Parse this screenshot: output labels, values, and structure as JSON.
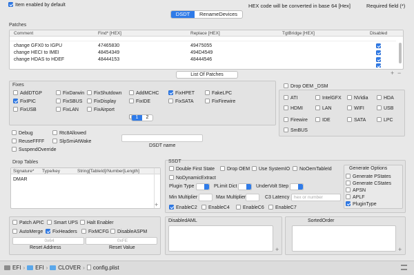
{
  "top": {
    "item_enabled_label": "Item enabled by default",
    "hex_note": "HEX code will be converted in base 64 [Hex]",
    "required_note": "Required field (*)",
    "tabs": [
      "DSDT",
      "RenameDevices"
    ]
  },
  "patches": {
    "title": "Patches",
    "columns": [
      "Comment",
      "Find* [HEX]",
      "Replace [HEX]",
      "TgtBridge [HEX]",
      "Disabled"
    ],
    "rows": [
      {
        "comment": "change GFX0 to IGPU",
        "find": "47465830",
        "replace": "49475055"
      },
      {
        "comment": "change HECI to IMEI",
        "find": "48454349",
        "replace": "494D4549"
      },
      {
        "comment": "change HDAS to HDEF",
        "find": "48444153",
        "replace": "48444546"
      }
    ],
    "list_button": "List Of Patches",
    "plus": "+",
    "minus": "−"
  },
  "fixes": {
    "title": "Fixes",
    "items": [
      {
        "label": "AddDTGP",
        "checked": false
      },
      {
        "label": "FixDarwin",
        "checked": false
      },
      {
        "label": "FixShutdown",
        "checked": false
      },
      {
        "label": "AddMCHC",
        "checked": false
      },
      {
        "label": "FixHPET",
        "checked": true
      },
      {
        "label": "FakeLPC",
        "checked": false
      },
      {
        "label": "FixIPIC",
        "checked": true
      },
      {
        "label": "FixSBUS",
        "checked": false
      },
      {
        "label": "FixDisplay",
        "checked": false
      },
      {
        "label": "FixIDE",
        "checked": false
      },
      {
        "label": "FixSATA",
        "checked": false
      },
      {
        "label": "FixFirewire",
        "checked": false
      },
      {
        "label": "FixUSB",
        "checked": false
      },
      {
        "label": "FixLAN",
        "checked": false
      },
      {
        "label": "FixAirport",
        "checked": false
      },
      {
        "label": "FixHDA",
        "checked": false
      }
    ],
    "pages": [
      "1",
      "2"
    ]
  },
  "drop_oem": {
    "label": "Drop OEM _DSM",
    "items": [
      "ATI",
      "IntelGFX",
      "NVidia",
      "HDA",
      "HDMI",
      "LAN",
      "WIFI",
      "USB",
      "Firewire",
      "IDE",
      "SATA",
      "LPC",
      "SmBUS"
    ]
  },
  "misc": {
    "items": [
      "Debug",
      "Rtc8Allowed",
      "ReuseFFFF",
      "SlpSmiAtWake",
      "SuspendOverride"
    ],
    "dsdt_name_label": "DSDT name",
    "dsdt_name_value": ""
  },
  "drop_tables": {
    "title": "Drop Tables",
    "columns": [
      "Signature*",
      "Type/key",
      "String[TableId]/Number[Length]"
    ],
    "rows": [
      {
        "signature": "DMAR",
        "type": "",
        "value": ""
      }
    ]
  },
  "ssdt": {
    "title": "SSDT",
    "row1": [
      {
        "label": "Double First State",
        "checked": false
      },
      {
        "label": "Drop OEM",
        "checked": false
      },
      {
        "label": "Use SystemIO",
        "checked": false
      },
      {
        "label": "NoOemTableId",
        "checked": false
      }
    ],
    "no_dynamic": "NoDynamicExtract",
    "plugin_type": "Plugin Type",
    "plimit_dict": "PLimit Dict",
    "undervolt_step": "UnderVolt Step",
    "min_multiplier": "Min Multiplier",
    "max_multiplier": "Max Multiplier",
    "c3_latency": "C3 Latency",
    "c3_placeholder": "hex or number",
    "enable_c": [
      {
        "label": "EnableC2",
        "checked": true
      },
      {
        "label": "EnableC4",
        "checked": false
      },
      {
        "label": "EnableC6",
        "checked": false
      },
      {
        "label": "EnableC7",
        "checked": false
      }
    ],
    "generate_title": "Generate Options",
    "generate": [
      {
        "label": "Generate PStates",
        "checked": false
      },
      {
        "label": "Generate CStates",
        "checked": false
      },
      {
        "label": "APSN",
        "checked": false
      },
      {
        "label": "APLF",
        "checked": false
      },
      {
        "label": "PluginType",
        "checked": true
      }
    ]
  },
  "bottom_left": {
    "items": [
      {
        "label": "Patch APIC",
        "checked": false
      },
      {
        "label": "Smart UPS",
        "checked": false
      },
      {
        "label": "Halt Enabler",
        "checked": false
      },
      {
        "label": "AutoMerge",
        "checked": false
      },
      {
        "label": "FixHeaders",
        "checked": true
      },
      {
        "label": "FixMCFG",
        "checked": false
      },
      {
        "label": "DisableASPM",
        "checked": false
      }
    ],
    "reset_placeholder_1": "0x64",
    "reset_placeholder_2": "0xFE",
    "reset_label": "Reset Address",
    "reset_value_label": "Reset Value"
  },
  "disabled_aml": {
    "title": "DisabledAML"
  },
  "sorted_order": {
    "title": "SortedOrder"
  },
  "breadcrumb": [
    "EFI",
    "EFI",
    "CLOVER",
    "config.plist"
  ]
}
